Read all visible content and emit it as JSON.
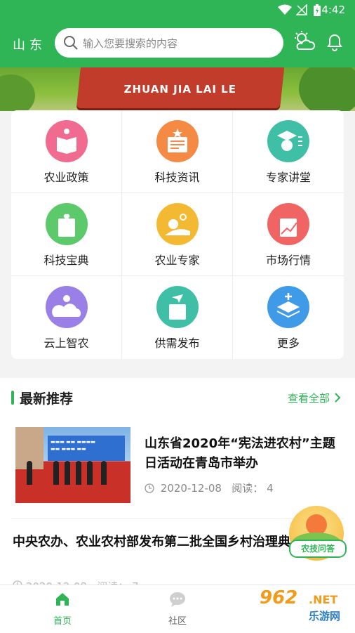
{
  "status_bar": {
    "time": "4:42"
  },
  "header": {
    "region": "山东",
    "search_placeholder": "输入您要搜索的内容",
    "weather_icon": "weather-cloud-sun-icon",
    "bell_icon": "bell-icon"
  },
  "banner": {
    "text": "ZHUAN JIA LAI LE"
  },
  "grid": {
    "items": [
      {
        "label": "农业政策",
        "icon": "book-icon",
        "color": "#f06b8f"
      },
      {
        "label": "科技资讯",
        "icon": "news-icon",
        "color": "#f58a45"
      },
      {
        "label": "专家讲堂",
        "icon": "teacher-icon",
        "color": "#3fc0a6"
      },
      {
        "label": "科技宝典",
        "icon": "handbook-icon",
        "color": "#5cc96a"
      },
      {
        "label": "农业专家",
        "icon": "field-icon",
        "color": "#f3b932"
      },
      {
        "label": "市场行情",
        "icon": "chart-up-icon",
        "color": "#f06464"
      },
      {
        "label": "云上智农",
        "icon": "cloud-icon",
        "color": "#9a7fe6"
      },
      {
        "label": "供需发布",
        "icon": "send-icon",
        "color": "#3fc0a6"
      },
      {
        "label": "更多",
        "icon": "layers-icon",
        "color": "#3f9be8"
      }
    ]
  },
  "recommend": {
    "title": "最新推荐",
    "more": "查看全部",
    "articles": [
      {
        "title": "山东省2020年“宪法进农村”主题日活动在青岛市举办",
        "date": "2020-12-08",
        "reads_label": "阅读：",
        "reads": "4"
      },
      {
        "title": "中央农办、农业农村部发布第二批全国乡村治理典型案例",
        "date": "2020-12-08",
        "reads_label": "阅读：",
        "reads": "7"
      }
    ]
  },
  "floating": {
    "label": "农技问答"
  },
  "tabs": [
    {
      "label": "首页",
      "active": true
    },
    {
      "label": "社区",
      "active": false
    }
  ],
  "watermark": {
    "num": "962",
    "net": ".NET",
    "cn": "乐游网"
  }
}
